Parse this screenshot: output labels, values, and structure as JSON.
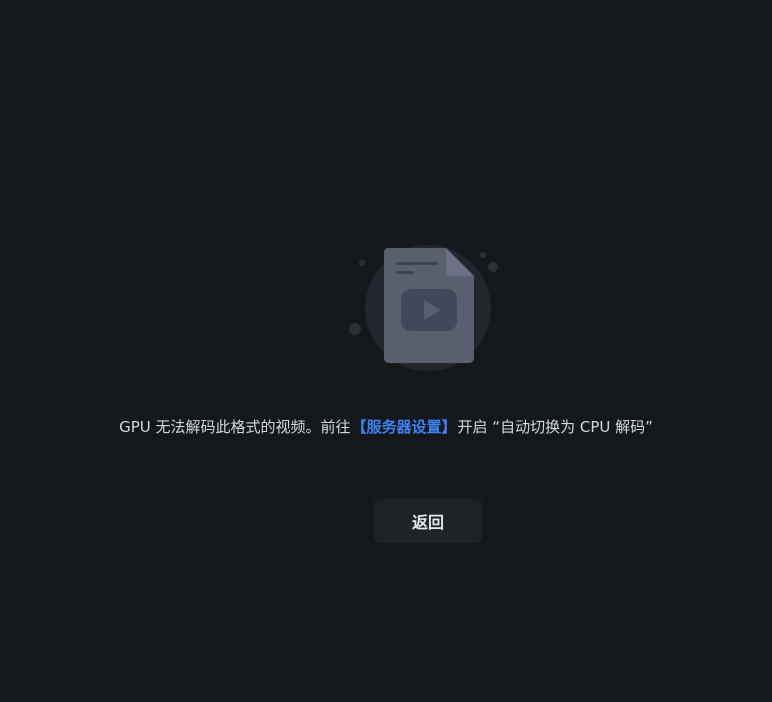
{
  "error": {
    "message_prefix": "GPU 无法解码此格式的视频。前往",
    "settings_link": "【服务器设置】",
    "message_suffix": "开启 “自动切换为 CPU 解码”"
  },
  "actions": {
    "back_label": "返回"
  },
  "colors": {
    "background": "#15181b",
    "link": "#3b82f6",
    "button_bg": "#1f2328",
    "illustration_circle": "#23262c",
    "illustration_doc": "#5a5f70"
  },
  "icons": {
    "illustration": "video-file-icon",
    "play": "play-icon"
  }
}
